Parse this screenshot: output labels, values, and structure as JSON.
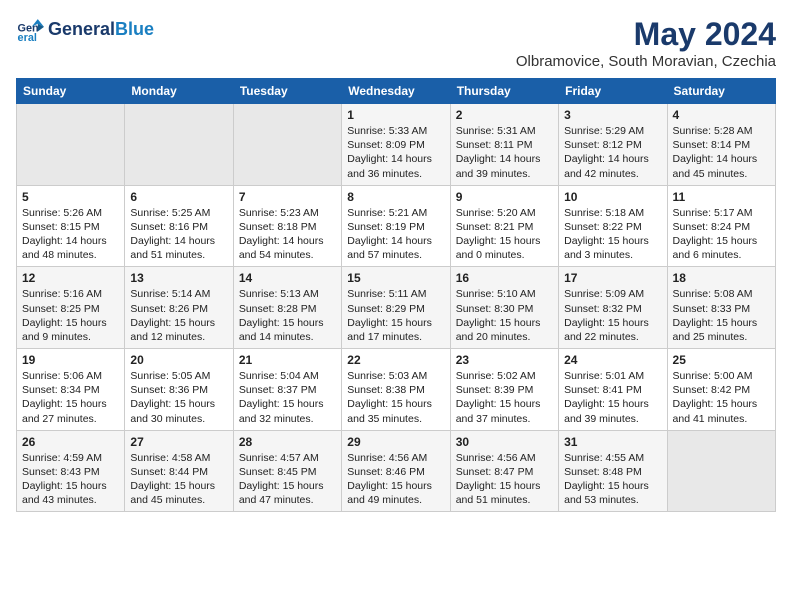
{
  "header": {
    "logo_line1": "General",
    "logo_line2": "Blue",
    "month_year": "May 2024",
    "location": "Olbramovice, South Moravian, Czechia"
  },
  "days_of_week": [
    "Sunday",
    "Monday",
    "Tuesday",
    "Wednesday",
    "Thursday",
    "Friday",
    "Saturday"
  ],
  "weeks": [
    [
      {
        "day": "",
        "empty": true
      },
      {
        "day": "",
        "empty": true
      },
      {
        "day": "",
        "empty": true
      },
      {
        "day": "1",
        "rise": "5:33 AM",
        "set": "8:09 PM",
        "daylight": "14 hours and 36 minutes."
      },
      {
        "day": "2",
        "rise": "5:31 AM",
        "set": "8:11 PM",
        "daylight": "14 hours and 39 minutes."
      },
      {
        "day": "3",
        "rise": "5:29 AM",
        "set": "8:12 PM",
        "daylight": "14 hours and 42 minutes."
      },
      {
        "day": "4",
        "rise": "5:28 AM",
        "set": "8:14 PM",
        "daylight": "14 hours and 45 minutes."
      }
    ],
    [
      {
        "day": "5",
        "rise": "5:26 AM",
        "set": "8:15 PM",
        "daylight": "14 hours and 48 minutes."
      },
      {
        "day": "6",
        "rise": "5:25 AM",
        "set": "8:16 PM",
        "daylight": "14 hours and 51 minutes."
      },
      {
        "day": "7",
        "rise": "5:23 AM",
        "set": "8:18 PM",
        "daylight": "14 hours and 54 minutes."
      },
      {
        "day": "8",
        "rise": "5:21 AM",
        "set": "8:19 PM",
        "daylight": "14 hours and 57 minutes."
      },
      {
        "day": "9",
        "rise": "5:20 AM",
        "set": "8:21 PM",
        "daylight": "15 hours and 0 minutes."
      },
      {
        "day": "10",
        "rise": "5:18 AM",
        "set": "8:22 PM",
        "daylight": "15 hours and 3 minutes."
      },
      {
        "day": "11",
        "rise": "5:17 AM",
        "set": "8:24 PM",
        "daylight": "15 hours and 6 minutes."
      }
    ],
    [
      {
        "day": "12",
        "rise": "5:16 AM",
        "set": "8:25 PM",
        "daylight": "15 hours and 9 minutes."
      },
      {
        "day": "13",
        "rise": "5:14 AM",
        "set": "8:26 PM",
        "daylight": "15 hours and 12 minutes."
      },
      {
        "day": "14",
        "rise": "5:13 AM",
        "set": "8:28 PM",
        "daylight": "15 hours and 14 minutes."
      },
      {
        "day": "15",
        "rise": "5:11 AM",
        "set": "8:29 PM",
        "daylight": "15 hours and 17 minutes."
      },
      {
        "day": "16",
        "rise": "5:10 AM",
        "set": "8:30 PM",
        "daylight": "15 hours and 20 minutes."
      },
      {
        "day": "17",
        "rise": "5:09 AM",
        "set": "8:32 PM",
        "daylight": "15 hours and 22 minutes."
      },
      {
        "day": "18",
        "rise": "5:08 AM",
        "set": "8:33 PM",
        "daylight": "15 hours and 25 minutes."
      }
    ],
    [
      {
        "day": "19",
        "rise": "5:06 AM",
        "set": "8:34 PM",
        "daylight": "15 hours and 27 minutes."
      },
      {
        "day": "20",
        "rise": "5:05 AM",
        "set": "8:36 PM",
        "daylight": "15 hours and 30 minutes."
      },
      {
        "day": "21",
        "rise": "5:04 AM",
        "set": "8:37 PM",
        "daylight": "15 hours and 32 minutes."
      },
      {
        "day": "22",
        "rise": "5:03 AM",
        "set": "8:38 PM",
        "daylight": "15 hours and 35 minutes."
      },
      {
        "day": "23",
        "rise": "5:02 AM",
        "set": "8:39 PM",
        "daylight": "15 hours and 37 minutes."
      },
      {
        "day": "24",
        "rise": "5:01 AM",
        "set": "8:41 PM",
        "daylight": "15 hours and 39 minutes."
      },
      {
        "day": "25",
        "rise": "5:00 AM",
        "set": "8:42 PM",
        "daylight": "15 hours and 41 minutes."
      }
    ],
    [
      {
        "day": "26",
        "rise": "4:59 AM",
        "set": "8:43 PM",
        "daylight": "15 hours and 43 minutes."
      },
      {
        "day": "27",
        "rise": "4:58 AM",
        "set": "8:44 PM",
        "daylight": "15 hours and 45 minutes."
      },
      {
        "day": "28",
        "rise": "4:57 AM",
        "set": "8:45 PM",
        "daylight": "15 hours and 47 minutes."
      },
      {
        "day": "29",
        "rise": "4:56 AM",
        "set": "8:46 PM",
        "daylight": "15 hours and 49 minutes."
      },
      {
        "day": "30",
        "rise": "4:56 AM",
        "set": "8:47 PM",
        "daylight": "15 hours and 51 minutes."
      },
      {
        "day": "31",
        "rise": "4:55 AM",
        "set": "8:48 PM",
        "daylight": "15 hours and 53 minutes."
      },
      {
        "day": "",
        "empty": true
      }
    ]
  ]
}
